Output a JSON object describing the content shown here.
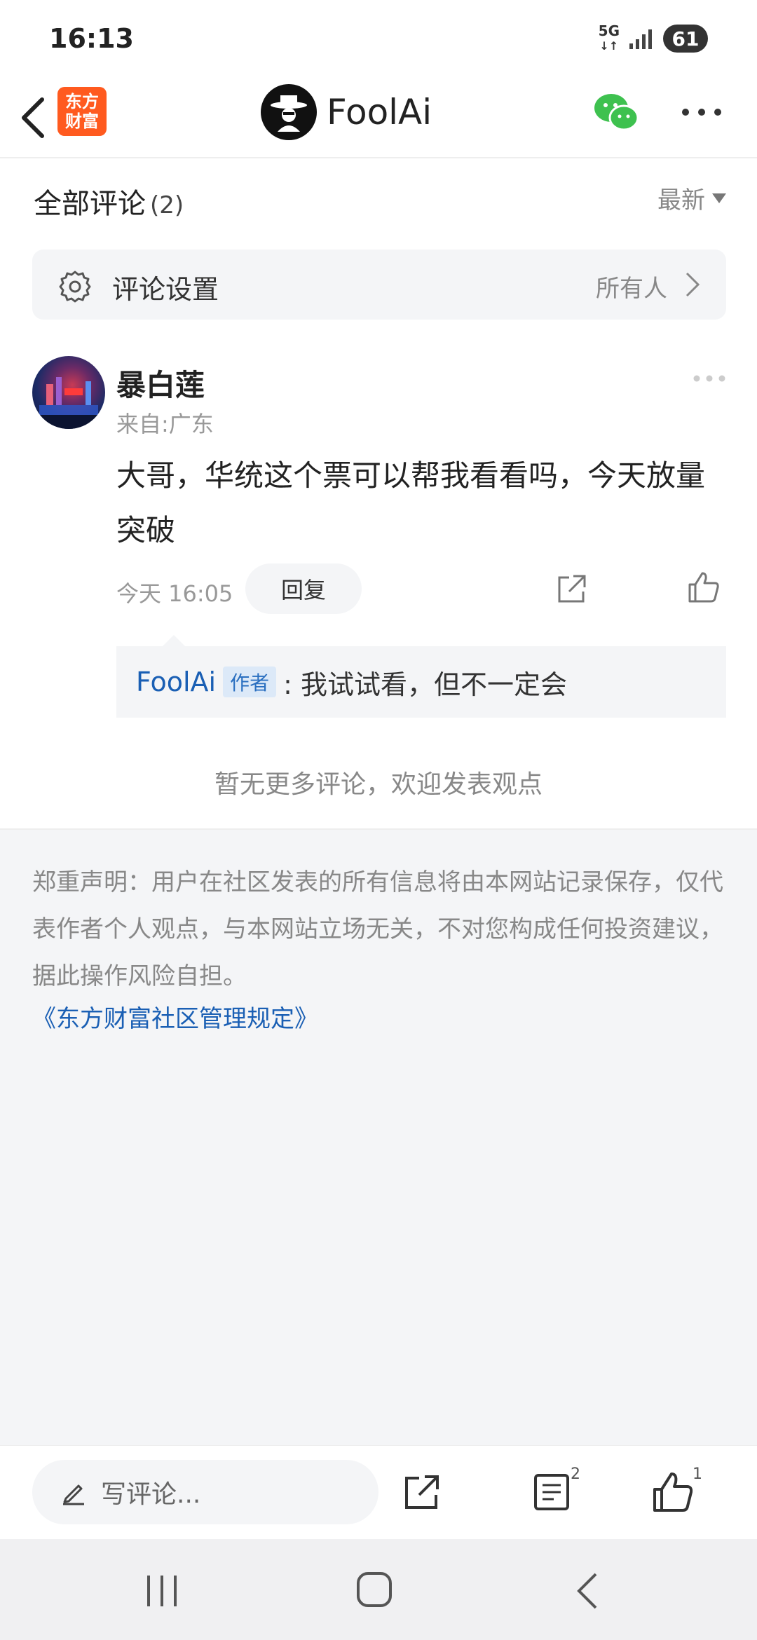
{
  "status_bar": {
    "time": "16:13",
    "network": "5G",
    "battery": "61"
  },
  "header": {
    "app_logo_line1": "东方",
    "app_logo_line2": "财富",
    "account_name": "FoolAi"
  },
  "comments_section": {
    "title": "全部评论",
    "count": "(2)",
    "sort_label": "最新",
    "settings_label": "评论设置",
    "settings_value": "所有人"
  },
  "comments": [
    {
      "username": "暴白莲",
      "location": "来自:广东",
      "text": "大哥，华统这个票可以帮我看看吗，今天放量突破",
      "time": "今天 16:05",
      "reply_button": "回复",
      "reply": {
        "author": "FoolAi",
        "badge": "作者",
        "text": ": 我试试看，但不一定会"
      }
    }
  ],
  "no_more_text": "暂无更多评论，欢迎发表观点",
  "disclaimer": {
    "text": "郑重声明：用户在社区发表的所有信息将由本网站记录保存，仅代表作者个人观点，与本网站立场无关，不对您构成任何投资建议，据此操作风险自担。",
    "link": "《东方财富社区管理规定》"
  },
  "bottom_bar": {
    "write_placeholder": "写评论...",
    "comment_count": "2",
    "like_count": "1"
  },
  "colors": {
    "brand_orange": "#ff5a1f",
    "link_blue": "#1a5fb4",
    "wechat_green": "#3ec14f"
  }
}
